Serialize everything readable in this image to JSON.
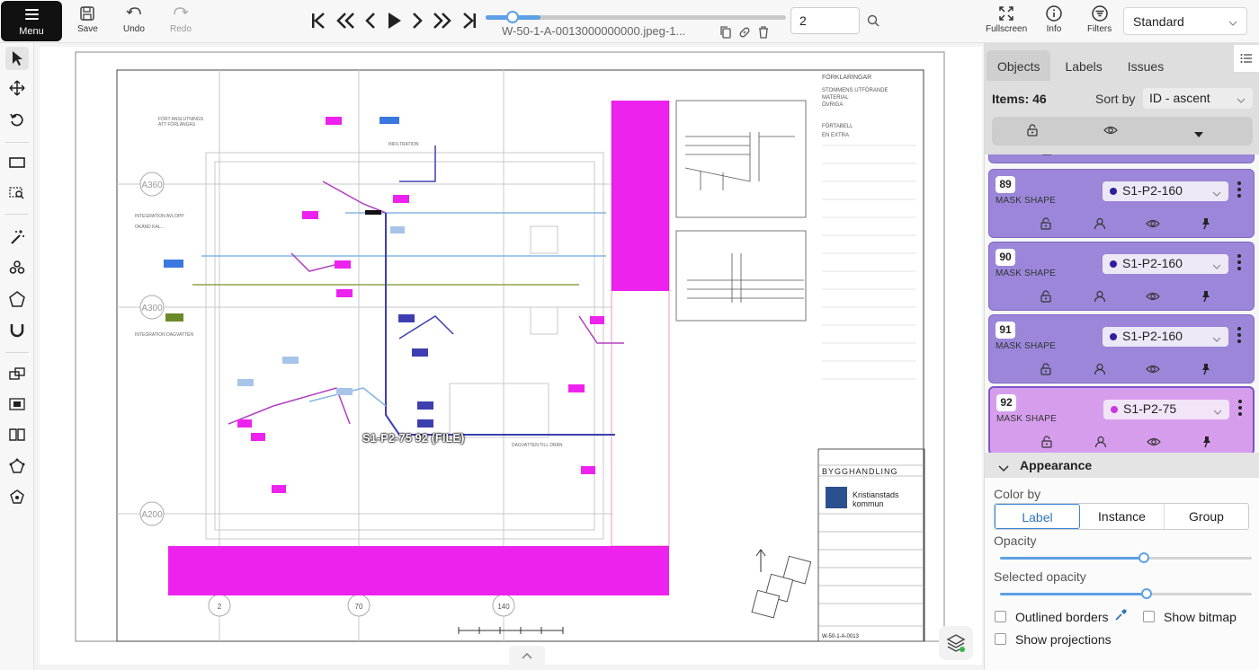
{
  "toolbar": {
    "menu_label": "Menu",
    "save_label": "Save",
    "undo_label": "Undo",
    "redo_label": "Redo",
    "filename": "W-50-1-A-0013000000000.jpeg-1...",
    "frame_value": "2",
    "fullscreen_label": "Fullscreen",
    "info_label": "Info",
    "filters_label": "Filters",
    "workspace_value": "Standard",
    "frame_progress": 0.04
  },
  "canvas": {
    "overlay_label": "S1-P2-75 92 (FILE)"
  },
  "sidebar": {
    "tabs": [
      "Objects",
      "Labels",
      "Issues"
    ],
    "active_tab": "Objects",
    "items_count": "Items: 46",
    "sort_label": "Sort by",
    "sort_value": "ID - ascent",
    "objects": [
      {
        "id": "89",
        "type": "MASK SHAPE",
        "label": "S1-P2-160",
        "color": "#2e1f9c",
        "style": "purple"
      },
      {
        "id": "90",
        "type": "MASK SHAPE",
        "label": "S1-P2-160",
        "color": "#2e1f9c",
        "style": "purple"
      },
      {
        "id": "91",
        "type": "MASK SHAPE",
        "label": "S1-P2-160",
        "color": "#2e1f9c",
        "style": "purple"
      },
      {
        "id": "92",
        "type": "MASK SHAPE",
        "label": "S1-P2-75",
        "color": "#c83be0",
        "style": "pink"
      }
    ],
    "appearance": {
      "title": "Appearance",
      "color_by_label": "Color by",
      "color_by_options": [
        "Label",
        "Instance",
        "Group"
      ],
      "color_by_selected": "Label",
      "opacity_label": "Opacity",
      "opacity_value": 0.57,
      "selected_opacity_label": "Selected opacity",
      "selected_opacity_value": 0.58,
      "outlined_borders_label": "Outlined borders",
      "show_bitmap_label": "Show bitmap",
      "show_projections_label": "Show projections"
    }
  }
}
